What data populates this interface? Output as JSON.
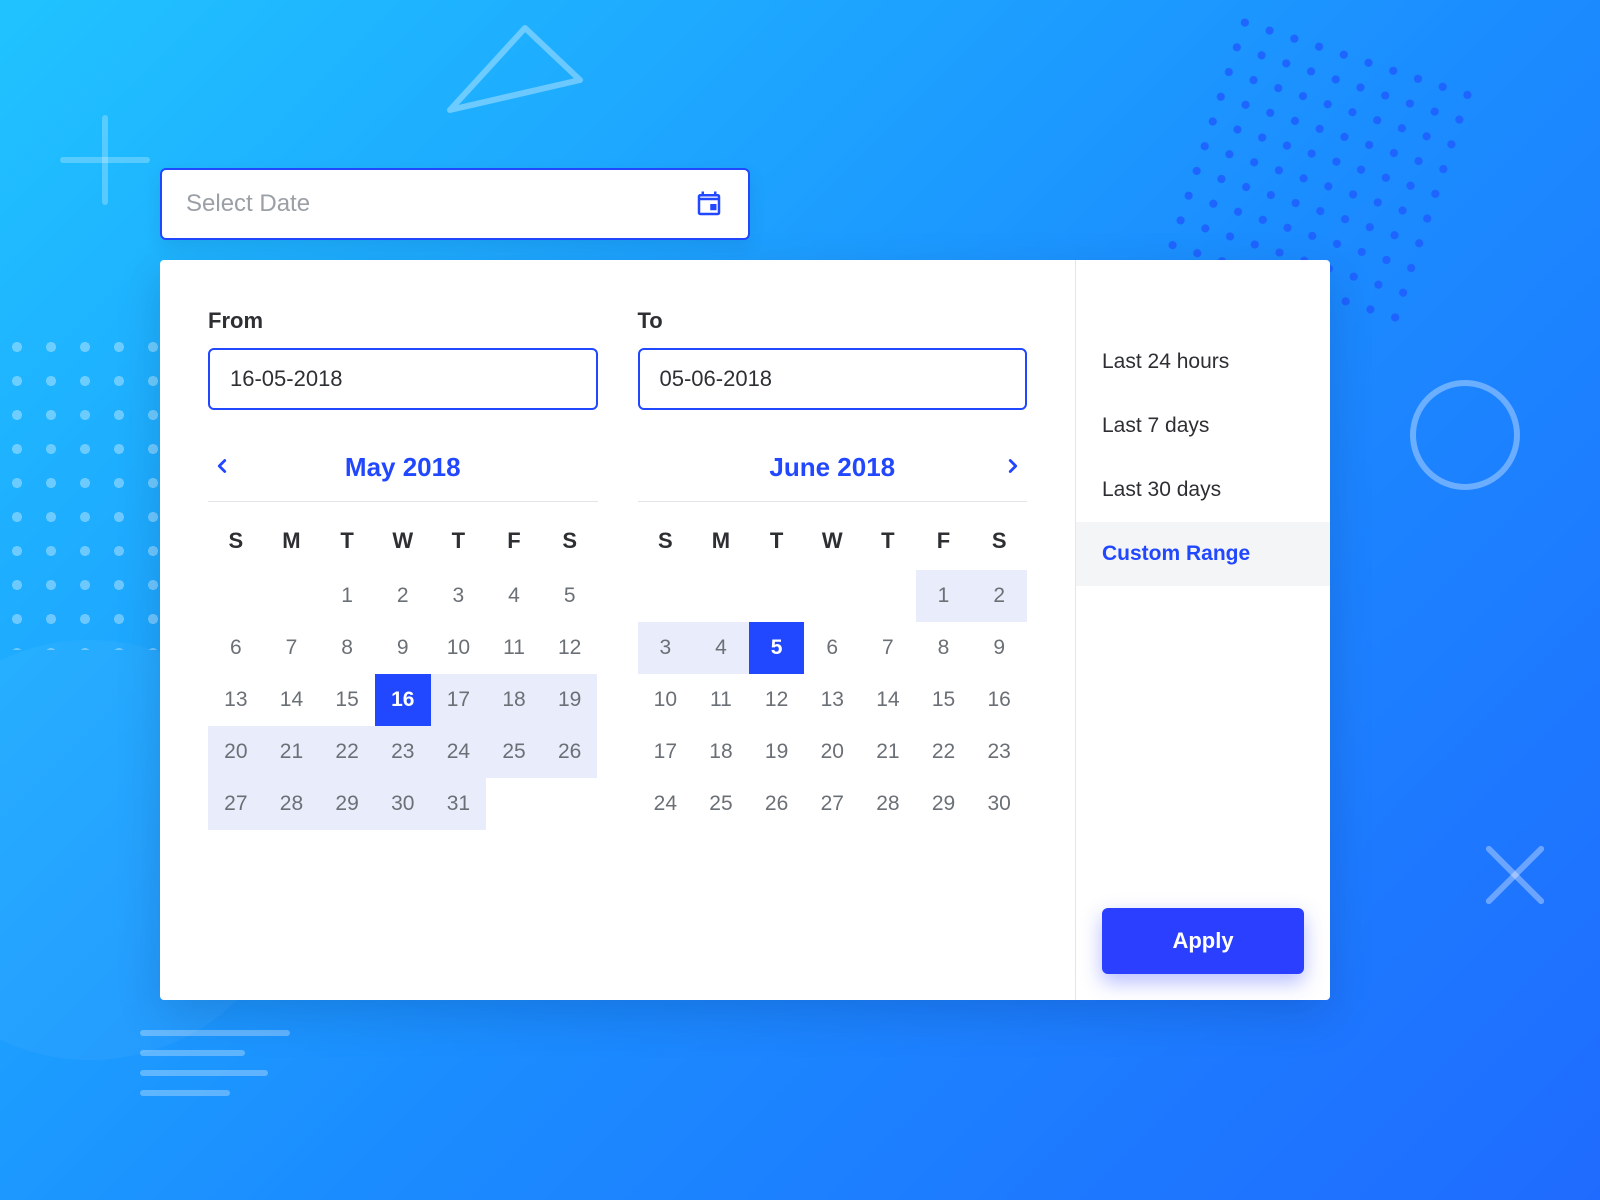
{
  "input": {
    "placeholder": "Select Date"
  },
  "range": {
    "from_label": "From",
    "to_label": "To",
    "from_value": "16-05-2018",
    "to_value": "05-06-2018"
  },
  "dow": [
    "S",
    "M",
    "T",
    "W",
    "T",
    "F",
    "S"
  ],
  "months": [
    {
      "title": "May 2018",
      "leading_blanks": 2,
      "days": 31,
      "selected": 16,
      "range_start": 16,
      "range_end": 31
    },
    {
      "title": "June 2018",
      "leading_blanks": 5,
      "days": 30,
      "selected": 5,
      "range_start": 1,
      "range_end": 5
    }
  ],
  "presets": [
    {
      "label": "Last 24 hours",
      "active": false
    },
    {
      "label": "Last 7 days",
      "active": false
    },
    {
      "label": "Last 30 days",
      "active": false
    },
    {
      "label": "Custom Range",
      "active": true
    }
  ],
  "apply_label": "Apply"
}
